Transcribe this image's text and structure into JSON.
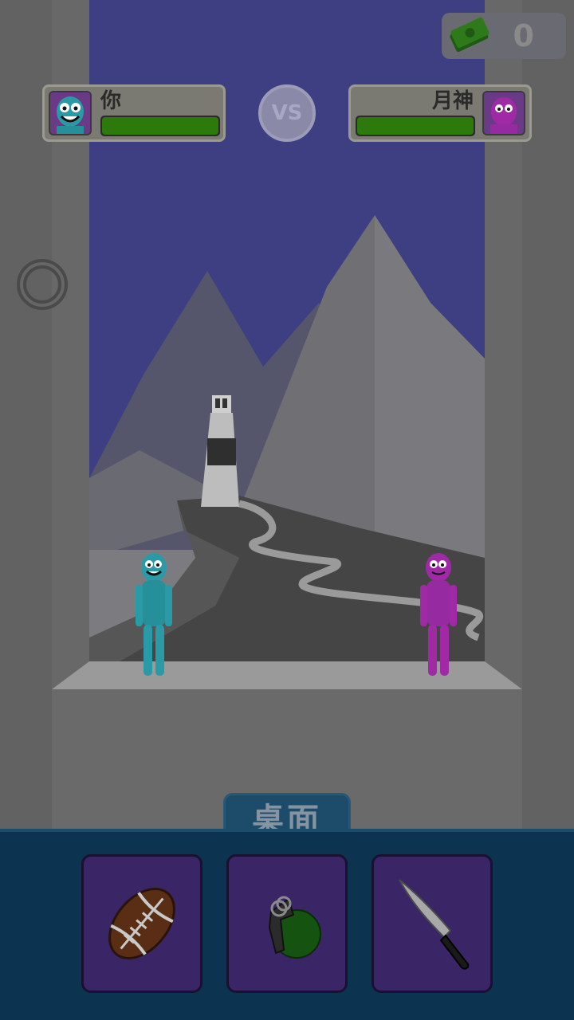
{
  "players": {
    "left": {
      "name": "你",
      "health": 1.0,
      "color": "#2a9ba6"
    },
    "right": {
      "name": "月神",
      "health": 1.0,
      "color": "#a02aa6"
    }
  },
  "vs_label": "VS",
  "currency": {
    "icon": "cash-icon",
    "value": "0"
  },
  "category_tab": "桌面",
  "weapons": [
    {
      "name": "football",
      "icon": "football-icon"
    },
    {
      "name": "grenade",
      "icon": "grenade-icon"
    },
    {
      "name": "knife",
      "icon": "knife-icon"
    }
  ],
  "colors": {
    "tray": "#0c3350",
    "tab": "#1d4b6a",
    "slot": "#3a2566",
    "hp_fill": "#2b7a0b",
    "sky": "#3e3e82"
  }
}
